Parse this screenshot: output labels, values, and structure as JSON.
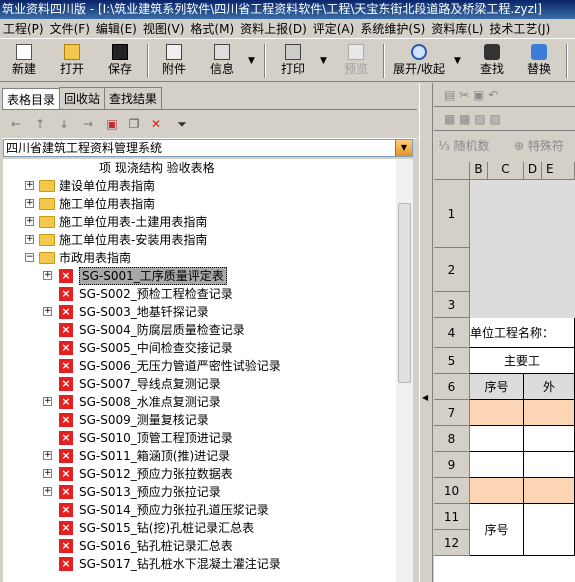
{
  "window": {
    "title": "筑业资料四川版 - [I:\\筑业建筑系列软件\\四川省工程资料软件\\工程\\天宝东街北段道路及桥梁工程.zyzl]"
  },
  "menu": [
    "工程(P)",
    "文件(F)",
    "编辑(E)",
    "视图(V)",
    "格式(M)",
    "资料上报(D)",
    "评定(A)",
    "系统维护(S)",
    "资料库(L)",
    "技术工艺(J)"
  ],
  "toolbar": {
    "new": "新建",
    "open": "打开",
    "save": "保存",
    "attach": "附件",
    "info": "信息",
    "print": "打印",
    "preview": "预览",
    "expand": "展开/收起",
    "find": "查找",
    "replace": "替换"
  },
  "tabs": [
    "表格目录",
    "回收站",
    "查找结果"
  ],
  "combo": {
    "value": "四川省建筑工程资料管理系统"
  },
  "tree": [
    {
      "label": "项  现浇结构 验收表格",
      "level": 4,
      "type": "item",
      "exp": ""
    },
    {
      "label": "建设单位用表指南",
      "level": 1,
      "type": "folder",
      "exp": "+"
    },
    {
      "label": "施工单位用表指南",
      "level": 1,
      "type": "folder",
      "exp": "+"
    },
    {
      "label": "施工单位用表-土建用表指南",
      "level": 1,
      "type": "folder",
      "exp": "+"
    },
    {
      "label": "施工单位用表-安装用表指南",
      "level": 1,
      "type": "folder",
      "exp": "+"
    },
    {
      "label": "市政用表指南",
      "level": 1,
      "type": "folder",
      "exp": "−"
    },
    {
      "label": "SG-S001_工序质量评定表",
      "level": 2,
      "type": "form",
      "exp": "+",
      "selected": true
    },
    {
      "label": "SG-S002_预检工程检查记录",
      "level": 2,
      "type": "form",
      "exp": ""
    },
    {
      "label": "SG-S003_地基钎探记录",
      "level": 2,
      "type": "form",
      "exp": "+"
    },
    {
      "label": "SG-S004_防腐层质量检查记录",
      "level": 2,
      "type": "form",
      "exp": ""
    },
    {
      "label": "SG-S005_中间检查交接记录",
      "level": 2,
      "type": "form",
      "exp": ""
    },
    {
      "label": "SG-S006_无压力管道严密性试验记录",
      "level": 2,
      "type": "form",
      "exp": ""
    },
    {
      "label": "SG-S007_导线点复测记录",
      "level": 2,
      "type": "form",
      "exp": ""
    },
    {
      "label": "SG-S008_水准点复测记录",
      "level": 2,
      "type": "form",
      "exp": "+"
    },
    {
      "label": "SG-S009_测量复核记录",
      "level": 2,
      "type": "form",
      "exp": ""
    },
    {
      "label": "SG-S010_顶管工程顶进记录",
      "level": 2,
      "type": "form",
      "exp": ""
    },
    {
      "label": "SG-S011_箱涵顶(推)进记录",
      "level": 2,
      "type": "form",
      "exp": "+"
    },
    {
      "label": "SG-S012_预应力张拉数据表",
      "level": 2,
      "type": "form",
      "exp": "+"
    },
    {
      "label": "SG-S013_预应力张拉记录",
      "level": 2,
      "type": "form",
      "exp": "+"
    },
    {
      "label": "SG-S014_预应力张拉孔道压浆记录",
      "level": 2,
      "type": "form",
      "exp": ""
    },
    {
      "label": "SG-S015_钻(挖)孔桩记录汇总表",
      "level": 2,
      "type": "form",
      "exp": ""
    },
    {
      "label": "SG-S016_钻孔桩记录汇总表",
      "level": 2,
      "type": "form",
      "exp": ""
    },
    {
      "label": "SG-S017_钻孔桩水下混凝土灌注记录",
      "level": 2,
      "type": "form",
      "exp": ""
    }
  ],
  "right": {
    "random": "随机数",
    "special": "特殊符"
  },
  "grid": {
    "cols": [
      "B",
      "C",
      "D",
      "E"
    ],
    "rows": [
      "1",
      "2",
      "3",
      "4",
      "5",
      "6",
      "7",
      "8",
      "9",
      "10",
      "11",
      "12"
    ],
    "unit_name": "单位工程名称：",
    "main_work": "主要工",
    "seq": "序号",
    "ext": "外",
    "seq2": "序号"
  }
}
